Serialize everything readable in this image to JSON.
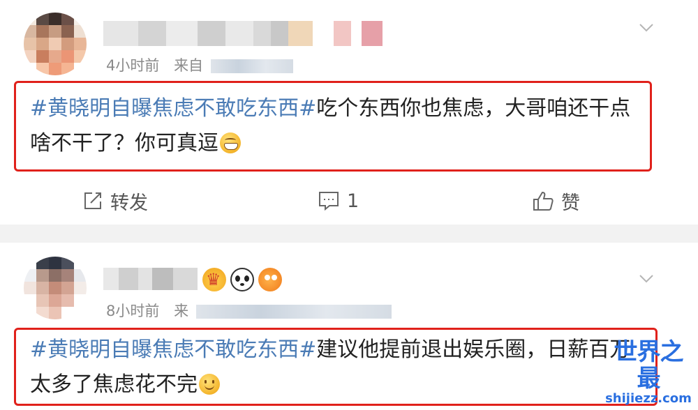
{
  "posts": [
    {
      "meta_time": "4小时前",
      "meta_from": "来自",
      "content_topic": "#黄晓明自曝焦虑不敢吃东西#",
      "content_text": "吃个东西你也焦虑，大哥咱还干点啥不干了？你可真逗",
      "emoji": "grin-emoji",
      "actions": {
        "repost_icon": "repost-icon",
        "repost_label": "转发",
        "comment_icon": "comment-icon",
        "comment_count": "1",
        "like_icon": "like-icon",
        "like_label": "赞"
      }
    },
    {
      "meta_time": "8小时前",
      "meta_from": "来",
      "content_topic": "#黄晓明自曝焦虑不敢吃东西#",
      "content_text": "建议他提前退出娱乐圈，日薪百万太多了焦虑花不完",
      "emoji": "smile-emoji",
      "badges": [
        "crown-badge-icon",
        "panda-badge-icon",
        "fish-badge-icon"
      ]
    }
  ],
  "watermark": {
    "main": "世界之最",
    "sub": "shijiezz.com"
  },
  "colors": {
    "highlight_border": "#e0211b",
    "topic": "#4a7bb5",
    "watermark": "#2a6fe0",
    "separator": "#f2f2f2"
  }
}
